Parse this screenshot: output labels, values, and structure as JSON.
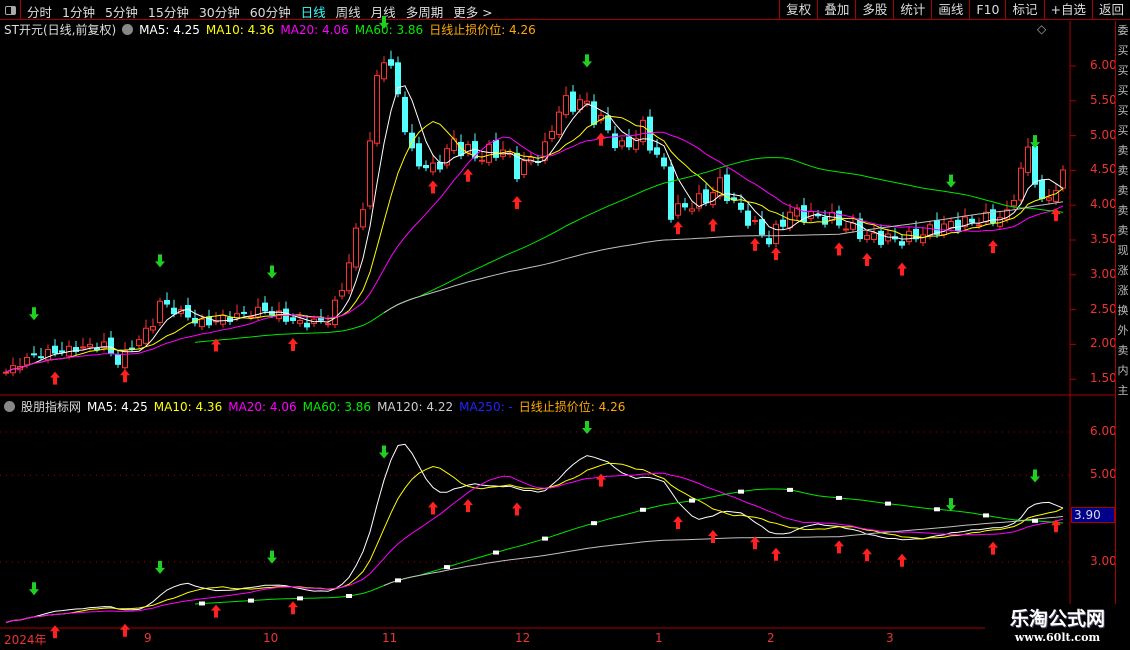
{
  "toolbar": {
    "periods": [
      "分时",
      "1分钟",
      "5分钟",
      "15分钟",
      "30分钟",
      "60分钟",
      "日线",
      "周线",
      "月线",
      "多周期",
      "更多 >"
    ],
    "active": "日线",
    "buttons": [
      "复权",
      "叠加",
      "多股",
      "统计",
      "画线",
      "F10",
      "标记",
      "+自选",
      "返回"
    ]
  },
  "main_legend": {
    "title": "ST开元(日线,前复权)",
    "ma5": "MA5: 4.25",
    "ma10": "MA10: 4.36",
    "ma20": "MA20: 4.06",
    "ma60": "MA60: 3.86",
    "stop": "日线止损价位: 4.26"
  },
  "sub_legend": {
    "title": "股朋指标网",
    "ma5": "MA5: 4.25",
    "ma10": "MA10: 4.36",
    "ma20": "MA20: 4.06",
    "ma60": "MA60: 3.86",
    "ma120": "MA120: 4.22",
    "ma250": "MA250: -",
    "stop": "日线止损价位: 4.26"
  },
  "main_axis": [
    "6.00",
    "5.50",
    "5.00",
    "4.50",
    "4.00",
    "3.50",
    "3.00",
    "2.50",
    "2.00",
    "1.50"
  ],
  "sub_axis": [
    "6.00",
    "5.00",
    "3.00"
  ],
  "cursor_value": "3.90",
  "dates": [
    {
      "label": "2024年",
      "bar": 0
    },
    {
      "label": "9",
      "bar": 20
    },
    {
      "label": "10",
      "bar": 37
    },
    {
      "label": "11",
      "bar": 54
    },
    {
      "label": "12",
      "bar": 73
    },
    {
      "label": "1",
      "bar": 93
    },
    {
      "label": "2",
      "bar": 109
    },
    {
      "label": "3",
      "bar": 126
    }
  ],
  "sidebar_chars": [
    "委",
    "买",
    "买",
    "买",
    "买",
    "买",
    "卖",
    "卖",
    "卖",
    "卖",
    "卖",
    "现",
    "涨",
    "涨",
    "换",
    "外",
    "卖",
    "内",
    "主"
  ],
  "colors": {
    "up": "#ff3232",
    "down": "#54ffff",
    "ma5": "#ffffff",
    "ma10": "#ffff00",
    "ma20": "#ff00ff",
    "ma60": "#00e600",
    "ma120": "#c0c0c0"
  },
  "price_keypoints": [
    [
      0,
      1.6
    ],
    [
      4,
      1.85
    ],
    [
      14,
      2.0
    ],
    [
      16,
      1.75
    ],
    [
      21,
      2.3
    ],
    [
      22,
      2.6
    ],
    [
      28,
      2.3
    ],
    [
      37,
      2.5
    ],
    [
      42,
      2.3
    ],
    [
      46,
      2.35
    ],
    [
      48,
      2.8
    ],
    [
      51,
      4.0
    ],
    [
      53,
      5.8
    ],
    [
      54,
      6.2
    ],
    [
      56,
      5.6
    ],
    [
      58,
      4.7
    ],
    [
      61,
      4.5
    ],
    [
      64,
      4.9
    ],
    [
      67,
      4.7
    ],
    [
      71,
      4.8
    ],
    [
      73,
      4.5
    ],
    [
      77,
      4.8
    ],
    [
      79,
      5.4
    ],
    [
      82,
      5.5
    ],
    [
      85,
      5.2
    ],
    [
      88,
      4.8
    ],
    [
      91,
      5.1
    ],
    [
      94,
      4.5
    ],
    [
      95,
      3.9
    ],
    [
      100,
      4.1
    ],
    [
      102,
      4.3
    ],
    [
      105,
      3.9
    ],
    [
      109,
      3.5
    ],
    [
      112,
      3.9
    ],
    [
      118,
      3.8
    ],
    [
      123,
      3.55
    ],
    [
      128,
      3.5
    ],
    [
      134,
      3.7
    ],
    [
      140,
      3.8
    ],
    [
      143,
      3.85
    ],
    [
      146,
      4.8
    ],
    [
      148,
      4.0
    ],
    [
      151,
      4.4
    ]
  ],
  "up_arrows": [
    7,
    17,
    30,
    41,
    61,
    66,
    73,
    85,
    96,
    101,
    107,
    110,
    119,
    123,
    128,
    141,
    150
  ],
  "down_arrows": [
    4,
    22,
    38,
    54,
    83,
    135,
    147
  ],
  "watermark": {
    "name": "乐淘公式网",
    "url": "www.60lt.com"
  }
}
